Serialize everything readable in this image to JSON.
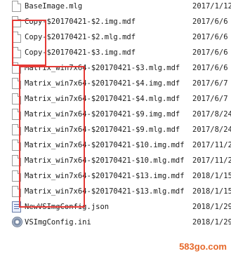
{
  "files": [
    {
      "name": "BaseImage.mlg",
      "date": "2017/1/12",
      "icon": "file-icon"
    },
    {
      "name": "Copy-$20170421-$2.img.mdf",
      "date": "2017/6/6",
      "icon": "file-icon"
    },
    {
      "name": "Copy-$20170421-$2.mlg.mdf",
      "date": "2017/6/6",
      "icon": "file-icon"
    },
    {
      "name": "Copy-$20170421-$3.img.mdf",
      "date": "2017/6/6",
      "icon": "file-icon"
    },
    {
      "name": "Matrix_win7x64-$20170421-$3.mlg.mdf",
      "date": "2017/6/6",
      "icon": "file-icon"
    },
    {
      "name": "Matrix_win7x64-$20170421-$4.img.mdf",
      "date": "2017/6/7",
      "icon": "file-icon"
    },
    {
      "name": "Matrix_win7x64-$20170421-$4.mlg.mdf",
      "date": "2017/6/7",
      "icon": "file-icon"
    },
    {
      "name": "Matrix_win7x64-$20170421-$9.img.mdf",
      "date": "2017/8/24",
      "icon": "file-icon"
    },
    {
      "name": "Matrix_win7x64-$20170421-$9.mlg.mdf",
      "date": "2017/8/24",
      "icon": "file-icon"
    },
    {
      "name": "Matrix_win7x64-$20170421-$10.img.mdf",
      "date": "2017/11/2",
      "icon": "file-icon"
    },
    {
      "name": "Matrix_win7x64-$20170421-$10.mlg.mdf",
      "date": "2017/11/2",
      "icon": "file-icon"
    },
    {
      "name": "Matrix_win7x64-$20170421-$13.img.mdf",
      "date": "2018/1/15",
      "icon": "file-icon"
    },
    {
      "name": "Matrix_win7x64-$20170421-$13.mlg.mdf",
      "date": "2018/1/15",
      "icon": "file-icon"
    },
    {
      "name": "NewVSImgConfig.json",
      "date": "2018/1/29",
      "icon": "json-icon"
    },
    {
      "name": "VSImgConfig.ini",
      "date": "2018/1/29",
      "icon": "ini-icon"
    }
  ],
  "highlight_color": "#e53935",
  "watermark": "583go.com"
}
